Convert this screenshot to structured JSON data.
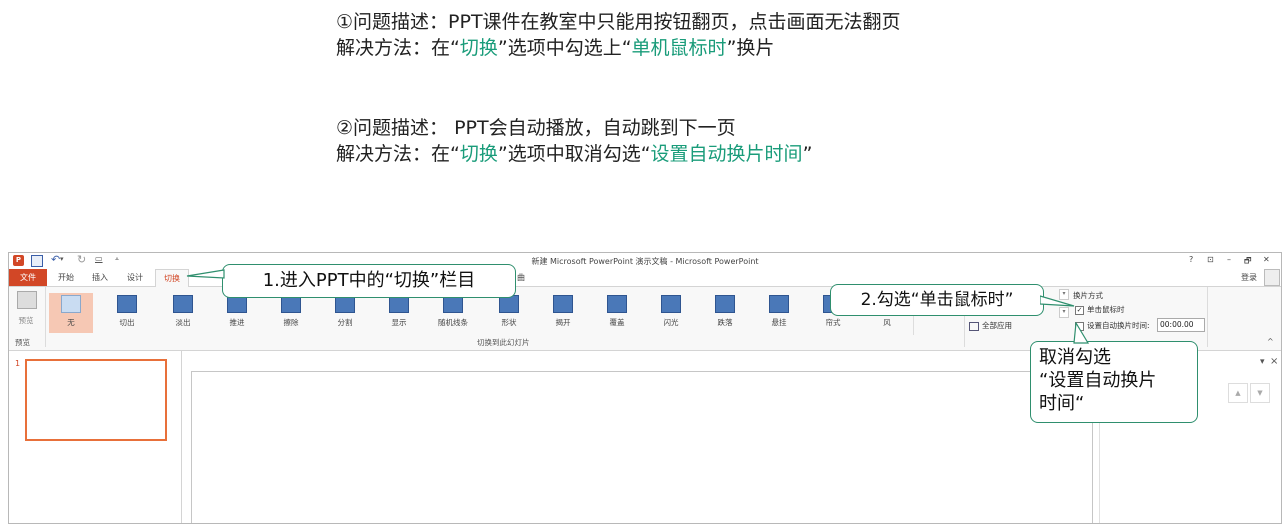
{
  "notes": {
    "n1_line1": "①问题描述：PPT课件在教室中只能用按钮翻页，点击画面无法翻页",
    "n1_line2_pre": " 解决方法：在“",
    "n1_line2_hl1": "切换",
    "n1_line2_mid": "”选项中勾选上“",
    "n1_line2_hl2": "单机鼠标时",
    "n1_line2_post": "”换片",
    "n2_line1": "②问题描述： PPT会自动播放，自动跳到下一页",
    "n2_line2_pre": " 解决方法：在“",
    "n2_line2_hl1": "切换",
    "n2_line2_mid": "”选项中取消勾选“",
    "n2_line2_hl2": "设置自动换片时间",
    "n2_line2_post": "”"
  },
  "window": {
    "title": "新建 Microsoft PowerPoint 演示文稿 - Microsoft PowerPoint",
    "controls": [
      "?",
      "⊡",
      "–",
      "🗗",
      "✕"
    ],
    "signin": "登录"
  },
  "tabs": {
    "file": "文件",
    "home": "开始",
    "insert": "插入",
    "design": "设计",
    "transitions": "切换",
    "hidden_tail": "曲"
  },
  "ribbon": {
    "preview": "预览",
    "preview_group": "预览",
    "transitions": [
      "无",
      "切出",
      "淡出",
      "推进",
      "擦除",
      "分割",
      "显示",
      "随机线条",
      "形状",
      "揭开",
      "覆盖",
      "闪光",
      "跌落",
      "悬挂",
      "帘式",
      "风"
    ],
    "transitions_group": "切换到此幻灯片",
    "apply_all": "全部应用",
    "advance_title": "换片方式",
    "on_click": "单击鼠标时",
    "after_time": "设置自动换片时间:",
    "time_value": "00:00.00"
  },
  "slide_panel": {
    "slide_number": "1"
  },
  "callouts": {
    "c1": "1.进入PPT中的“切换”栏目",
    "c2": "2.勾选“单击鼠标时”",
    "c3_l1": "取消勾选",
    "c3_l2": "“设置自动换片",
    "c3_l3": "时间“"
  },
  "colors": {
    "accent_green": "#1a9c7a",
    "file_tab": "#d24726",
    "selected_transition": "#f6c8b4",
    "slide_border": "#e8703a"
  }
}
